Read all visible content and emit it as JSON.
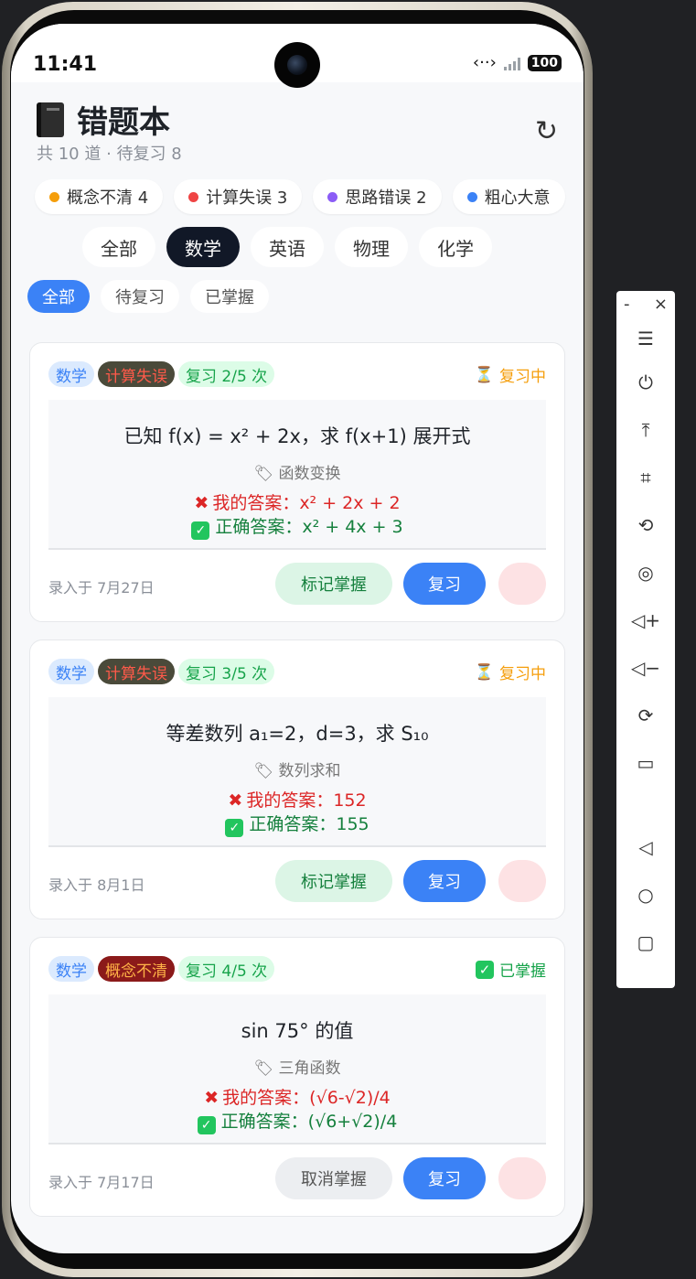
{
  "status_bar": {
    "time": "11:41",
    "battery": "100"
  },
  "header": {
    "title": "错题本",
    "subtitle": "共 10 道 · 待复习 8",
    "refresh_icon": "↻"
  },
  "reasons": [
    {
      "label": "概念不清 4",
      "color": "#f59e0b"
    },
    {
      "label": "计算失误 3",
      "color": "#ef4444"
    },
    {
      "label": "思路错误 2",
      "color": "#8b5cf6"
    },
    {
      "label": "粗心大意",
      "color": "#3b82f6"
    }
  ],
  "subjects": [
    "全部",
    "数学",
    "英语",
    "物理",
    "化学"
  ],
  "active_subject": "数学",
  "filters": [
    "全部",
    "待复习",
    "已掌握"
  ],
  "active_filter": "全部",
  "cards": [
    {
      "subject": "数学",
      "reason": "计算失误",
      "review": "复习 2/5 次",
      "status": "复习中",
      "question": "已知 f(x) = x² + 2x，求 f(x+1) 展开式",
      "topic": "函数变换",
      "my_answer": "我的答案：x² + 2x + 2",
      "correct_answer": "正确答案：x² + 4x + 3",
      "date": "录入于 7月27日",
      "mark_label": "标记掌握",
      "review_label": "复习"
    },
    {
      "subject": "数学",
      "reason": "计算失误",
      "review": "复习 3/5 次",
      "status": "复习中",
      "question": "等差数列 a₁=2，d=3，求 S₁₀",
      "topic": "数列求和",
      "my_answer": "我的答案：152",
      "correct_answer": "正确答案：155",
      "date": "录入于 8月1日",
      "mark_label": "标记掌握",
      "review_label": "复习"
    },
    {
      "subject": "数学",
      "reason": "概念不清",
      "review": "复习 4/5 次",
      "status": "已掌握",
      "question": "sin 75° 的值",
      "topic": "三角函数",
      "my_answer": "我的答案：(√6-√2)/4",
      "correct_answer": "正确答案：(√6+√2)/4",
      "date": "录入于 7月17日",
      "mark_label": "取消掌握",
      "review_label": "复习"
    }
  ],
  "toolbar": {
    "minimize": "-",
    "close": "×",
    "icons": [
      "menu-icon",
      "power-icon",
      "pin-top-icon",
      "crop-icon",
      "rotate-icon",
      "screenshot-icon",
      "volume-up-icon",
      "volume-down-icon",
      "rotate-device-icon",
      "switch-screen-icon",
      "back-icon",
      "home-icon",
      "recents-icon"
    ]
  }
}
